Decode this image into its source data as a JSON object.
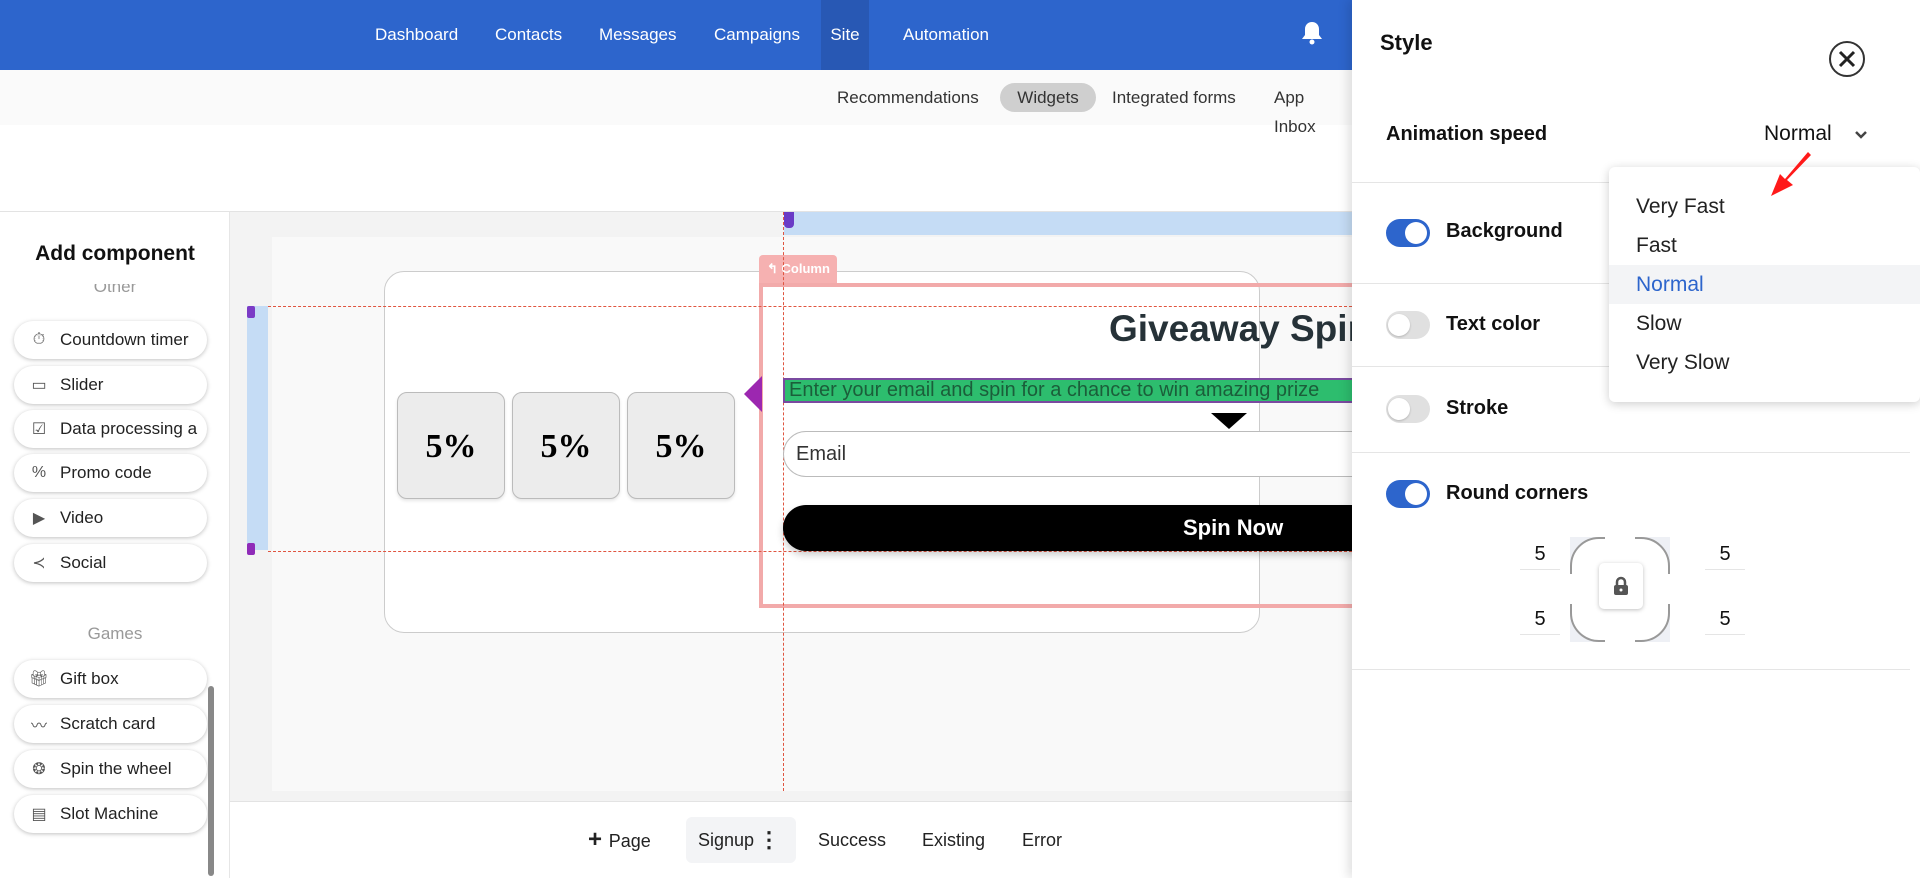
{
  "topnav": {
    "items": [
      "Dashboard",
      "Contacts",
      "Messages",
      "Campaigns",
      "Site",
      "Automation"
    ],
    "active": "Site",
    "bell_icon": "bell-icon"
  },
  "subnav": {
    "items": [
      "Recommendations",
      "Widgets",
      "Integrated forms",
      "App Inbox"
    ],
    "active": "Widgets"
  },
  "left_panel": {
    "title": "Add component",
    "other_label": "Other",
    "other_items": [
      {
        "label": "Countdown timer",
        "icon": "timer-icon"
      },
      {
        "label": "Slider",
        "icon": "slider-icon"
      },
      {
        "label": "Data processing a",
        "icon": "checkbox-icon"
      },
      {
        "label": "Promo code",
        "icon": "percent-icon"
      },
      {
        "label": "Video",
        "icon": "play-icon"
      },
      {
        "label": "Social",
        "icon": "share-icon"
      }
    ],
    "games_label": "Games",
    "games_items": [
      {
        "label": "Gift box",
        "icon": "gift-icon"
      },
      {
        "label": "Scratch card",
        "icon": "scratch-icon"
      },
      {
        "label": "Spin the wheel",
        "icon": "wheel-icon"
      },
      {
        "label": "Slot Machine",
        "icon": "slot-machine-icon"
      }
    ]
  },
  "canvas": {
    "column_label": "Column",
    "slots": [
      "5%",
      "5%",
      "5%"
    ],
    "title": "Giveaway Spin",
    "subtitle": "Enter your email and spin for a chance to win amazing prize",
    "email_placeholder": "Email",
    "button_label": "Spin Now"
  },
  "bottom_bar": {
    "add_page": "Page",
    "pages": [
      "Signup",
      "Success",
      "Existing",
      "Error"
    ],
    "active": "Signup"
  },
  "style_panel": {
    "title": "Style",
    "animation_speed_label": "Animation speed",
    "animation_speed_value": "Normal",
    "toggles": [
      {
        "label": "Background",
        "on": true
      },
      {
        "label": "Text color",
        "on": false
      },
      {
        "label": "Stroke",
        "on": false
      },
      {
        "label": "Round corners",
        "on": true
      }
    ],
    "corners": {
      "top_left": "5",
      "top_right": "5",
      "bottom_left": "5",
      "bottom_right": "5"
    },
    "dropdown_options": [
      "Very Fast",
      "Fast",
      "Normal",
      "Slow",
      "Very Slow"
    ],
    "dropdown_selected": "Normal"
  },
  "colors": {
    "brand": "#2d65cc",
    "highlight": "#2dbd6e",
    "annotation_arrow": "#ff1a1a"
  }
}
